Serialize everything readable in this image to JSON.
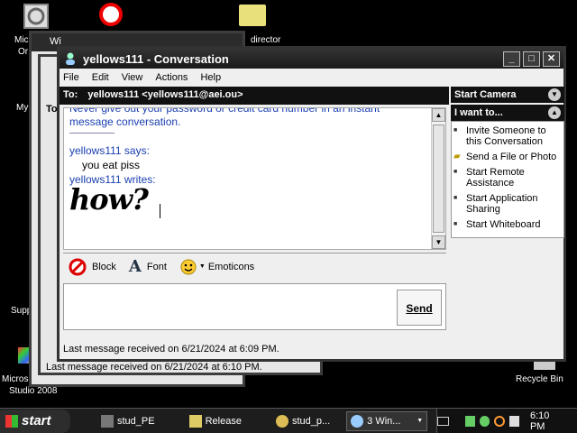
{
  "desktop": {
    "left_icons": [
      "Mic",
      "Or",
      "My",
      "Supp",
      "Microsoft",
      "Studio 2008"
    ],
    "top_right_icon_label": "director",
    "recycle_label": "Recycle Bin"
  },
  "bg_windows": {
    "win1_title": "Wi",
    "win2_letters": "To",
    "status_text": "Last message received on 6/21/2024 at 6:10 PM."
  },
  "conversation": {
    "title": "yellows111 - Conversation",
    "menu": [
      "File",
      "Edit",
      "View",
      "Actions",
      "Help"
    ],
    "to_label": "To:",
    "to_value": "yellows111 <yellows111@aei.ou>",
    "history": {
      "warning_line1": "Never give out your password or credit card number in an instant",
      "warning_line2": "message conversation.",
      "says_line": "yellows111 says:",
      "message": "you eat piss",
      "writes_line": "yellows111 writes:",
      "ink": "how?"
    },
    "toolbar": {
      "block": "Block",
      "font": "Font",
      "emoticons": "Emoticons"
    },
    "send": "Send",
    "status": "Last message received on 6/21/2024 at 6:09 PM.",
    "side": {
      "camera_header": "Start Camera",
      "iwant_header": "I want to...",
      "items": [
        "Invite Someone to this Conversation",
        "Send a File or Photo",
        "Start Remote Assistance",
        "Start Application Sharing",
        "Start Whiteboard"
      ]
    }
  },
  "taskbar": {
    "start": "start",
    "tasks": [
      "stud_PE",
      "Release",
      "stud_p...",
      "3 Win..."
    ],
    "clock": "6:10 PM"
  }
}
